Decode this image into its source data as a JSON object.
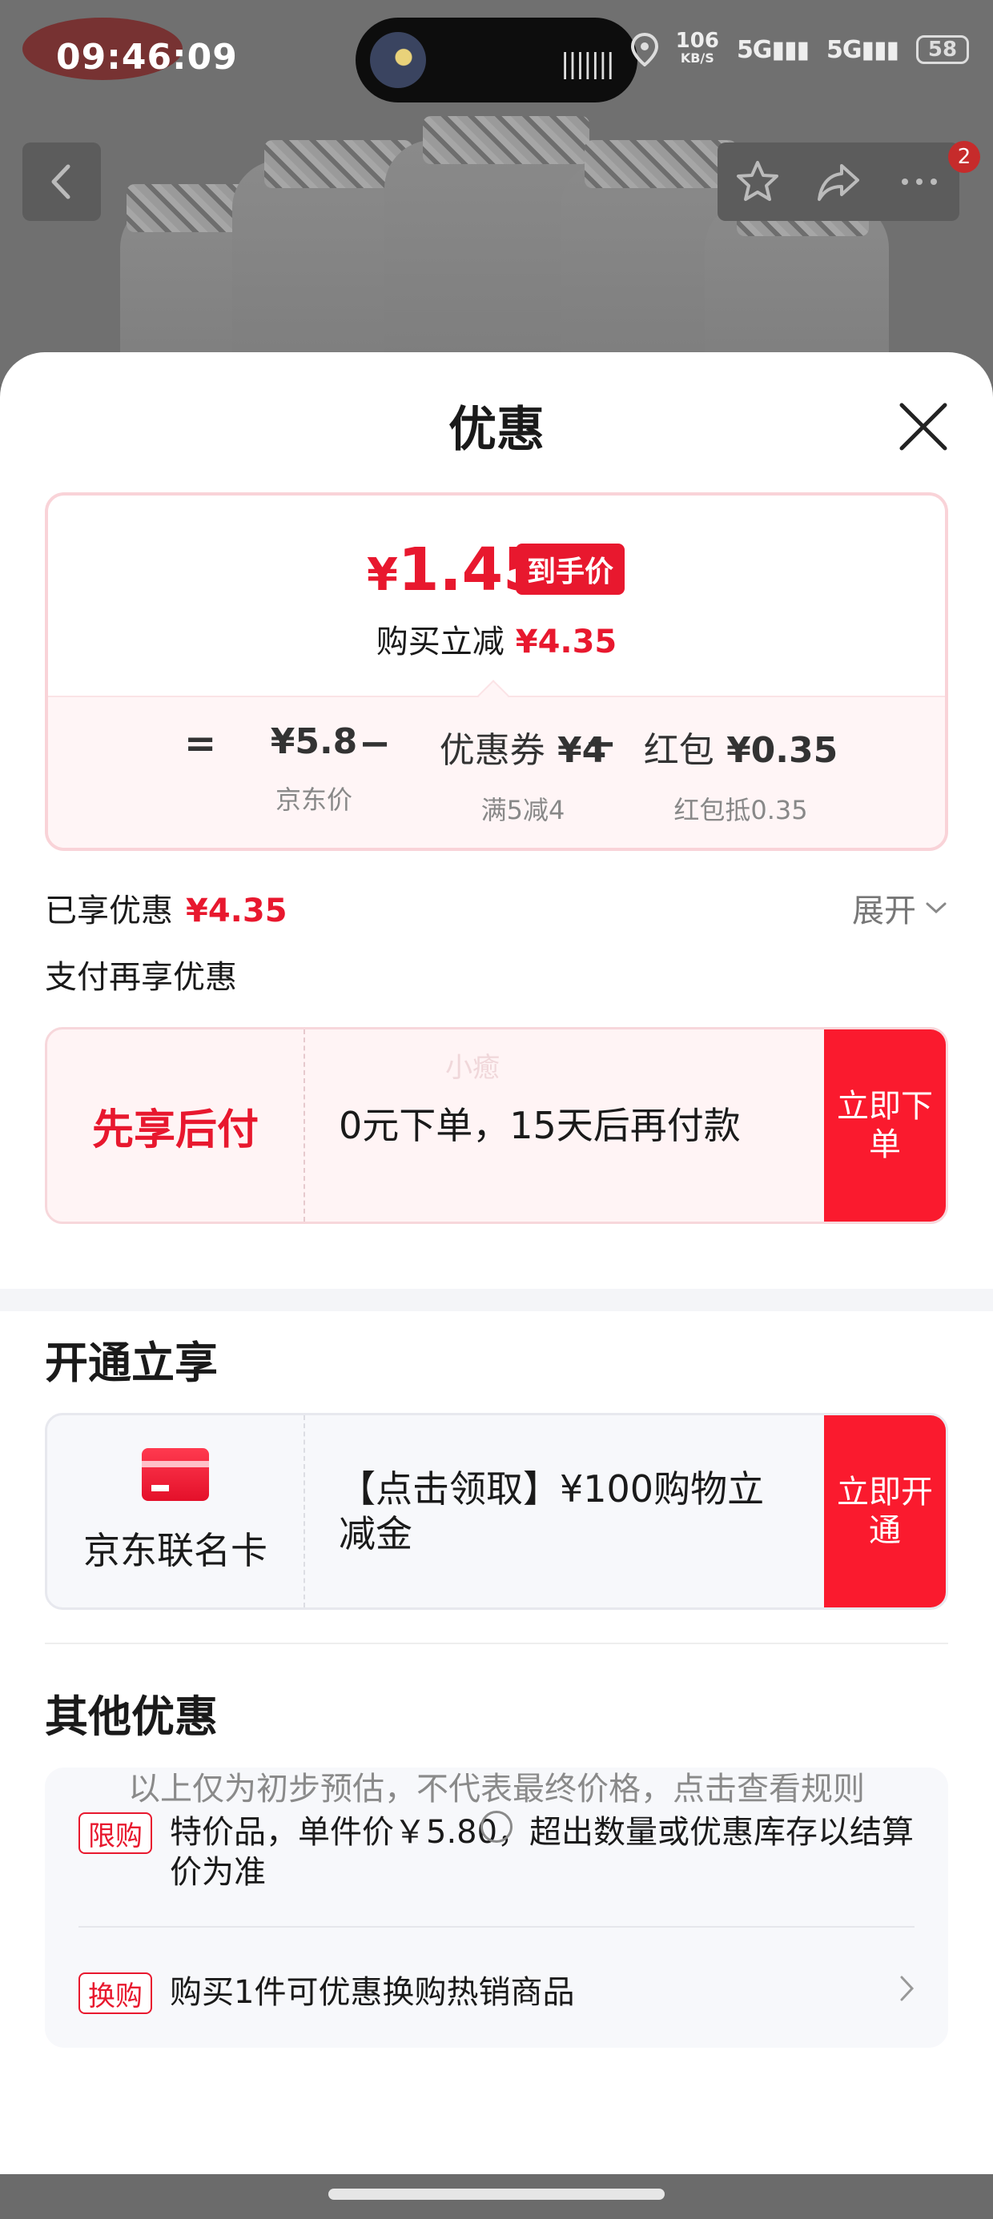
{
  "status_bar": {
    "time": "09:46:09",
    "net_speed": "106",
    "net_unit": "KB/S",
    "signal_1": "5G",
    "signal_2": "5G",
    "battery": "58"
  },
  "nav": {
    "badge_count": "2"
  },
  "sheet": {
    "title": "优惠"
  },
  "price_card": {
    "currency": "¥",
    "final_price": "1.45",
    "final_tag": "到手价",
    "save_label": "购买立减",
    "save_amount": "¥4.35",
    "equation": {
      "eq_sign": "=",
      "minus_1": "−",
      "minus_2": "−",
      "jd_price": "¥5.8",
      "jd_price_label": "京东价",
      "coupon_prefix": "优惠券",
      "coupon_value": "¥4",
      "coupon_label": "满5减4",
      "redpack_prefix": "红包",
      "redpack_value": "¥0.35",
      "redpack_label": "红包抵0.35"
    }
  },
  "enjoyed": {
    "label": "已享优惠",
    "amount": "¥4.35",
    "expand_label": "展开"
  },
  "pay_more": {
    "label": "支付再享优惠",
    "card_title": "先享后付",
    "card_text": "0元下单，15天后再付款",
    "watermark": "小癒",
    "button": "立即下单"
  },
  "open_section": {
    "title": "开通立享",
    "card_name": "京东联名卡",
    "card_text": "【点击领取】¥100购物立减金",
    "button": "立即开通"
  },
  "other_section": {
    "title": "其他优惠",
    "items": [
      {
        "tag": "限购",
        "text": "特价品，单件价￥5.80，超出数量或优惠库存以结算价为准"
      },
      {
        "tag": "换购",
        "text": "购买1件可优惠换购热销商品"
      }
    ]
  },
  "footnote": "以上仅为初步预估，不代表最终价格，点击查看规则",
  "colors": {
    "accent": "#e8182e",
    "button": "#fa1a2e"
  }
}
